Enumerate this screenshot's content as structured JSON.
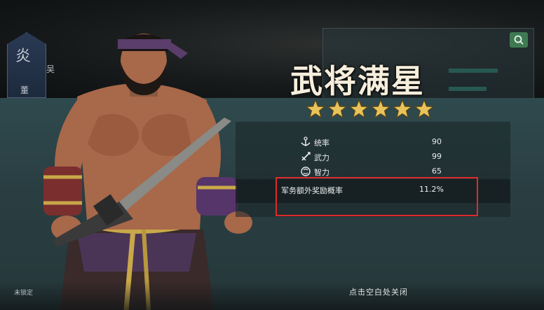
{
  "faction": {
    "glyph": "炎",
    "footer": "董",
    "side_label": "吴"
  },
  "title": "武将满星",
  "star_count": 6,
  "stats": [
    {
      "icon": "anchor-icon",
      "label": "统率",
      "value": "90"
    },
    {
      "icon": "sword-icon",
      "label": "武力",
      "value": "99"
    },
    {
      "icon": "brain-icon",
      "label": "智力",
      "value": "65"
    }
  ],
  "bonus": {
    "label": "军务额外奖励概率",
    "value": "11.2%"
  },
  "footer": {
    "lock_text": "未锁定",
    "close_hint": "点击空白处关闭"
  },
  "colors": {
    "highlight": "#e02a2a",
    "star": "#e8c35a",
    "panel": "#2f4a4e"
  }
}
